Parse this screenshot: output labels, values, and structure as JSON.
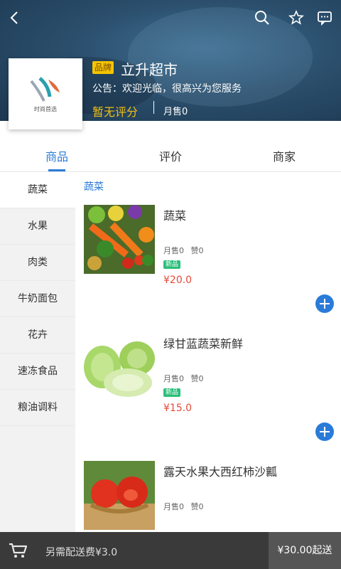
{
  "header": {
    "brand_badge": "品牌",
    "shop_name": "立升超市",
    "notice": "公告：欢迎光临，很高兴为您服务",
    "rating_text": "暂无评分",
    "monthly_sales": "月售0",
    "logo_caption": "时尚首选"
  },
  "tabs": [
    {
      "label": "商品",
      "active": true
    },
    {
      "label": "评价",
      "active": false
    },
    {
      "label": "商家",
      "active": false
    }
  ],
  "categories": [
    {
      "label": "蔬菜",
      "active": true
    },
    {
      "label": "水果",
      "active": false
    },
    {
      "label": "肉类",
      "active": false
    },
    {
      "label": "牛奶面包",
      "active": false
    },
    {
      "label": "花卉",
      "active": false
    },
    {
      "label": "速冻食品",
      "active": false
    },
    {
      "label": "粮油调料",
      "active": false
    }
  ],
  "section_title": "蔬菜",
  "products": [
    {
      "name": "蔬菜",
      "sales": "月售0",
      "likes": "赞0",
      "badge": "新品",
      "price": "¥20.0"
    },
    {
      "name": "绿甘蓝蔬菜新鲜",
      "sales": "月售0",
      "likes": "赞0",
      "badge": "新品",
      "price": "¥15.0"
    },
    {
      "name": "露天水果大西红柿沙瓤",
      "sales": "月售0",
      "likes": "赞0",
      "badge": "",
      "price": ""
    }
  ],
  "bottom_bar": {
    "delivery_fee": "另需配送费¥3.0",
    "min_order": "¥30.00起送"
  },
  "colors": {
    "accent": "#2a7bd8",
    "price": "#e34a3a",
    "rating": "#f2c014",
    "new_badge": "#2bbf7a"
  },
  "icons": [
    "back-arrow-icon",
    "search-icon",
    "star-icon",
    "message-icon",
    "cart-icon",
    "add-icon"
  ]
}
